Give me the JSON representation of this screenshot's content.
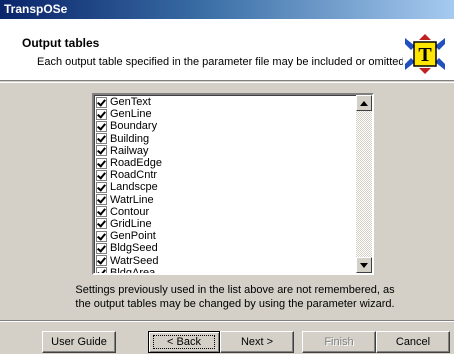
{
  "window": {
    "title": "TranspOSe"
  },
  "header": {
    "title": "Output tables",
    "description": "Each output table specified in the parameter file may be included or omitted.",
    "icon": "transpose-logo-icon",
    "logo_letter": "T"
  },
  "list": {
    "items": [
      {
        "label": "GenText",
        "checked": true
      },
      {
        "label": "GenLine",
        "checked": true
      },
      {
        "label": "Boundary",
        "checked": true
      },
      {
        "label": "Building",
        "checked": true
      },
      {
        "label": "Railway",
        "checked": true
      },
      {
        "label": "RoadEdge",
        "checked": true
      },
      {
        "label": "RoadCntr",
        "checked": true
      },
      {
        "label": "Landscpe",
        "checked": true
      },
      {
        "label": "WatrLine",
        "checked": true
      },
      {
        "label": "Contour",
        "checked": true
      },
      {
        "label": "GridLine",
        "checked": true
      },
      {
        "label": "GenPoint",
        "checked": true
      },
      {
        "label": "BldgSeed",
        "checked": true
      },
      {
        "label": "WatrSeed",
        "checked": true
      },
      {
        "label": "BldgArea",
        "checked": true
      }
    ]
  },
  "note": {
    "line1": "Settings previously used in the list above are not remembered, as",
    "line2": "the output tables may be changed by using the parameter wizard."
  },
  "buttons": {
    "user_guide": "User Guide",
    "back": "< Back",
    "next": "Next >",
    "finish": "Finish",
    "cancel": "Cancel"
  }
}
